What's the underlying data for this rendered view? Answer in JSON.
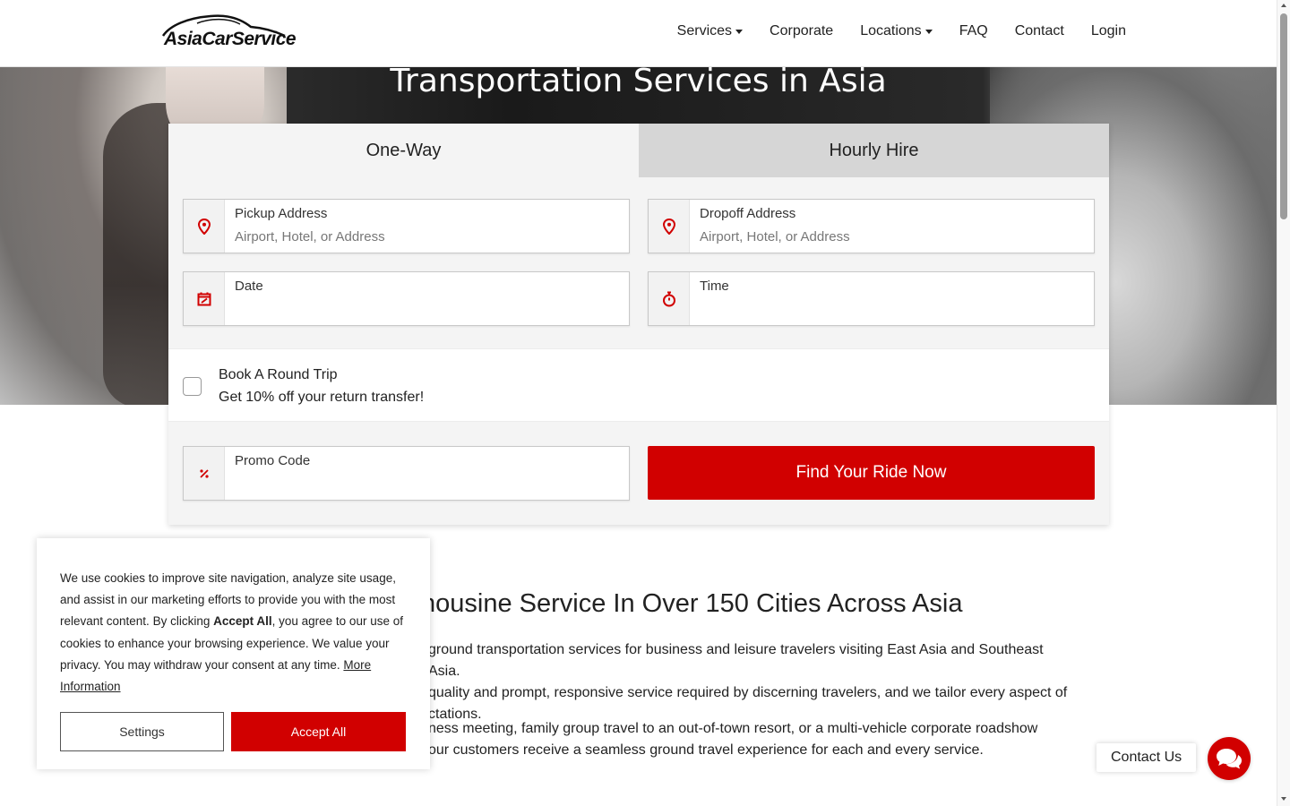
{
  "brand": {
    "logo_text": "AsiaCarService"
  },
  "nav": {
    "items": [
      {
        "label": "Services",
        "dropdown": true
      },
      {
        "label": "Corporate",
        "dropdown": false
      },
      {
        "label": "Locations",
        "dropdown": true
      },
      {
        "label": "FAQ",
        "dropdown": false
      },
      {
        "label": "Contact",
        "dropdown": false
      },
      {
        "label": "Login",
        "dropdown": false
      }
    ]
  },
  "hero": {
    "title": "Transportation Services in Asia"
  },
  "booking": {
    "tabs": [
      {
        "label": "One-Way",
        "active": true
      },
      {
        "label": "Hourly Hire",
        "active": false
      }
    ],
    "pickup": {
      "label": "Pickup Address",
      "placeholder": "Airport, Hotel, or Address",
      "icon": "map-pin-icon"
    },
    "dropoff": {
      "label": "Dropoff Address",
      "placeholder": "Airport, Hotel, or Address",
      "icon": "map-pin-icon"
    },
    "date": {
      "label": "Date",
      "placeholder": "",
      "icon": "calendar-icon"
    },
    "time": {
      "label": "Time",
      "placeholder": "",
      "icon": "stopwatch-icon"
    },
    "round_trip": {
      "title": "Book A Round Trip",
      "subtitle": "Get 10% off your return transfer!",
      "checked": false
    },
    "promo": {
      "label": "Promo Code",
      "placeholder": "",
      "icon": "percent-icon"
    },
    "submit_label": "Find Your Ride Now"
  },
  "content": {
    "title": "nousine Service In Over 150 Cities Across Asia",
    "para1": [
      "ground transportation services for business and leisure travelers visiting East Asia and Southeast Asia.",
      "quality and prompt, responsive service required by discerning  travelers, and we tailor every aspect of",
      "ctations."
    ],
    "para2": [
      "ness meeting, family group travel to an out-of-town resort, or a multi-vehicle corporate roadshow",
      "our customers receive a seamless ground travel experience for each and every service."
    ]
  },
  "cookie": {
    "text_before": "We use cookies to improve site navigation, analyze site usage, and assist in our marketing efforts to provide you with the most relevant content. By clicking ",
    "accept_all_bold": "Accept All",
    "text_after": ", you agree to our use of cookies to enhance your browsing experience. We value your privacy. You may withdraw your consent at any time. ",
    "more_link": "More Information",
    "settings_label": "Settings",
    "accept_label": "Accept All"
  },
  "contact": {
    "label": "Contact Us",
    "icon": "chat-bubbles-icon"
  },
  "colors": {
    "accent": "#d10000",
    "tab_inactive": "#d6d6d6",
    "card_bg": "#f4f4f4"
  }
}
